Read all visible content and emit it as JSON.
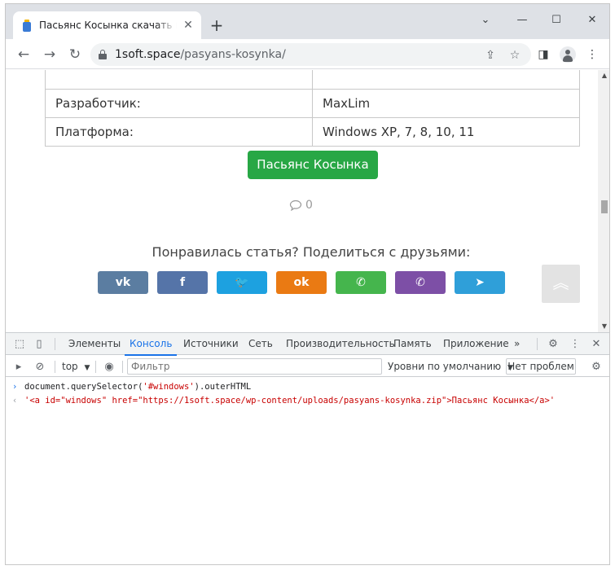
{
  "browser": {
    "tab": {
      "title": "Пасьянс Косынка скачать игру бесплатно",
      "close_glyph": "✕"
    },
    "new_tab_glyph": "+",
    "window_controls": {
      "dropdown": "⌄",
      "minimize": "—",
      "maximize": "☐",
      "close": "✕"
    },
    "nav": {
      "back": "←",
      "forward": "→",
      "reload": "↻"
    },
    "address": {
      "host": "1soft.space",
      "path": "/pasyans-kosynka/"
    },
    "omnibox_icons": {
      "share": "⇪",
      "bookmark": "☆"
    },
    "toolbar_icons": {
      "sidebar": "◨",
      "menu": "⋮"
    }
  },
  "page": {
    "table": [
      {
        "label": "Разработчик:",
        "value": "MaxLim"
      },
      {
        "label": "Платформа:",
        "value": "Windows XP, 7, 8, 10, 11"
      }
    ],
    "download_button": "Пасьянс Косынка",
    "comments_count": "0",
    "share_title": "Понравилась статья? Поделиться с друзьями:",
    "share_buttons": [
      {
        "name": "vk",
        "glyph": "vk",
        "color": "#5b7da1"
      },
      {
        "name": "facebook",
        "glyph": "f",
        "color": "#5574a8"
      },
      {
        "name": "twitter",
        "glyph": "🐦",
        "color": "#1da1e0"
      },
      {
        "name": "odnoklassniki",
        "glyph": "ok",
        "color": "#ea7a13"
      },
      {
        "name": "whatsapp",
        "glyph": "✆",
        "color": "#45b54d"
      },
      {
        "name": "viber",
        "glyph": "✆",
        "color": "#7d4fa6"
      },
      {
        "name": "telegram",
        "glyph": "➤",
        "color": "#2f9fd9"
      }
    ],
    "scroll_top_glyph": "︽"
  },
  "devtools": {
    "tabs": [
      "Элементы",
      "Консоль",
      "Источники",
      "Сеть",
      "Производительность",
      "Память",
      "Приложение"
    ],
    "active_tab": "Консоль",
    "more_glyph": "»",
    "filterbar": {
      "context": "top",
      "filter_placeholder": "Фильтр",
      "levels": "Уровни по умолчанию",
      "issues": "Нет проблем"
    },
    "console": {
      "input": "document.querySelector('#windows').outerHTML",
      "input_pre": "document.querySelector(",
      "input_str": "'#windows'",
      "input_post": ").outerHTML",
      "output": "'<a id=\"windows\" href=\"https://1soft.space/wp-content/uploads/pasyans-kosynka.zip\">Пасьянс Косынка</a>'"
    }
  },
  "colors": {
    "download_button": "#28a745",
    "devtools_accent": "#1a73e8",
    "console_string": "#c80000"
  }
}
